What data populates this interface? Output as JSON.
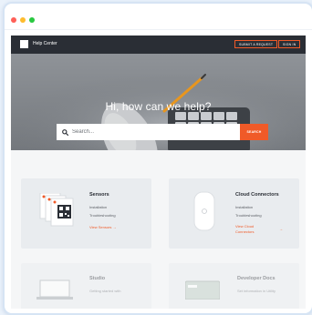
{
  "colors": {
    "accent": "#f05a28",
    "nav_bg": "#2a2e35",
    "card_bg": "#e9ecef"
  },
  "window_dots": [
    "#ff5f57",
    "#febc2e",
    "#28c840"
  ],
  "nav": {
    "brand": "Help Center",
    "submit_request_label": "SUBMIT A REQUEST",
    "sign_in_label": "SIGN IN"
  },
  "hero": {
    "title": "Hi, how can we help?",
    "search_placeholder": "Search...",
    "search_button_label": "SEARCH"
  },
  "categories": [
    {
      "title": "Sensors",
      "links": [
        "Installation",
        "Troubleshooting"
      ],
      "cta": "View Sensors →",
      "icon": "sensor-tags-icon"
    },
    {
      "title": "Cloud Connectors",
      "links": [
        "Installation",
        "Troubleshooting"
      ],
      "cta_line1": "View Cloud",
      "cta_line2": "Connectors",
      "cta_arrow": "→",
      "icon": "connector-device-icon"
    },
    {
      "title": "Studio",
      "links": [
        "Getting started with"
      ],
      "icon": "laptop-icon"
    },
    {
      "title": "Developer Docs",
      "links": [
        "Set information in Utility"
      ],
      "icon": "card-icon"
    }
  ]
}
